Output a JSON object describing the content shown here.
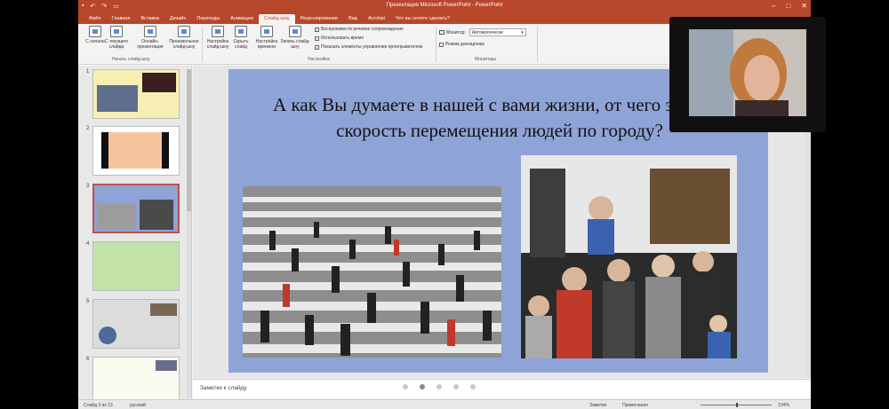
{
  "window": {
    "title": "Презентация Microsoft PowerPoint - PowerPoint"
  },
  "tabs": [
    "Файл",
    "Главная",
    "Вставка",
    "Дизайн",
    "Переходы",
    "Анимация",
    "Слайд-шоу",
    "Рецензирование",
    "Вид",
    "Acrobat",
    "Что вы хотите сделать?"
  ],
  "active_tab": "Слайд-шоу",
  "ribbon": {
    "start": {
      "buttons": [
        "С начала",
        "С текущего слайда",
        "Онлайн-презентация",
        "Произвольное слайд-шоу"
      ],
      "group_label": "Начать слайд-шоу"
    },
    "setup": {
      "buttons": [
        "Настройка слайд-шоу",
        "Скрыть слайд",
        "Настройка времени",
        "Запись слайд-шоу"
      ],
      "checkboxes": [
        "Воспроизвести речевое сопровождение",
        "Использовать время",
        "Показать элементы управления проигрывателем"
      ],
      "group_label": "Настройка"
    },
    "monitors": {
      "monitor_label": "Монитор:",
      "monitor_value": "Автоматически",
      "presenter_view": "Режим докладчика",
      "group_label": "Мониторы"
    }
  },
  "thumbnails": {
    "numbers": [
      "1",
      "2",
      "3",
      "4",
      "5",
      "6"
    ],
    "selected": "3"
  },
  "slide": {
    "title": "А как Вы думаете в нашей с вами жизни, от чего зависит скорость перемещения людей по городу?"
  },
  "notes": {
    "placeholder": "Заметки к слайду"
  },
  "status": {
    "slide": "Слайд 3 из 13",
    "language": "русский",
    "notes_btn": "Заметки",
    "comments_btn": "Примечания",
    "zoom": "104%"
  },
  "colors": {
    "accent": "#b7472a",
    "slide_bg": "#8ea3d6"
  }
}
